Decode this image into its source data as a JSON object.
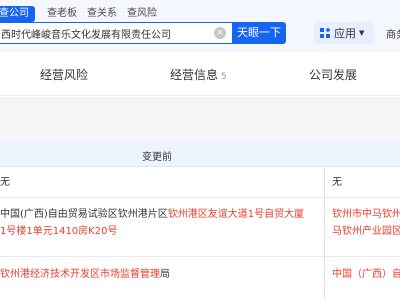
{
  "search": {
    "tabs": [
      "查公司",
      "查老板",
      "查关系",
      "查风险"
    ],
    "query": "西时代峰峻音乐文化发展有限责任公司",
    "button_label": "天眼一下"
  },
  "header": {
    "apps_label": "应用",
    "right_link": "商务"
  },
  "module_tabs": [
    {
      "label": "经营风险",
      "count": ""
    },
    {
      "label": "经营信息",
      "count": "5"
    },
    {
      "label": "公司发展",
      "count": ""
    }
  ],
  "table": {
    "col_before": "变更前",
    "rows": [
      {
        "before": "无",
        "after": "无"
      },
      {
        "before_plain_1": "中国(广西)自由贸易试验区钦州港片区",
        "before_hl_1": "钦州港区友谊大道1号自贸大厦",
        "before_hl_2": "1号楼1单元1410房K20号",
        "after_hl_1": "钦州市中马钦州",
        "after_hl_2": "马钦州产业园区"
      },
      {
        "before_hl": "钦州港经济技术开发区市场监督管理",
        "before_plain": "局",
        "after_hl": "中国（广西）自"
      }
    ]
  },
  "colors": {
    "primary": "#1565f2",
    "highlight": "#ec3d2c",
    "header_bg": "#f4f7fe",
    "table_head_bg": "#eef4fe"
  }
}
